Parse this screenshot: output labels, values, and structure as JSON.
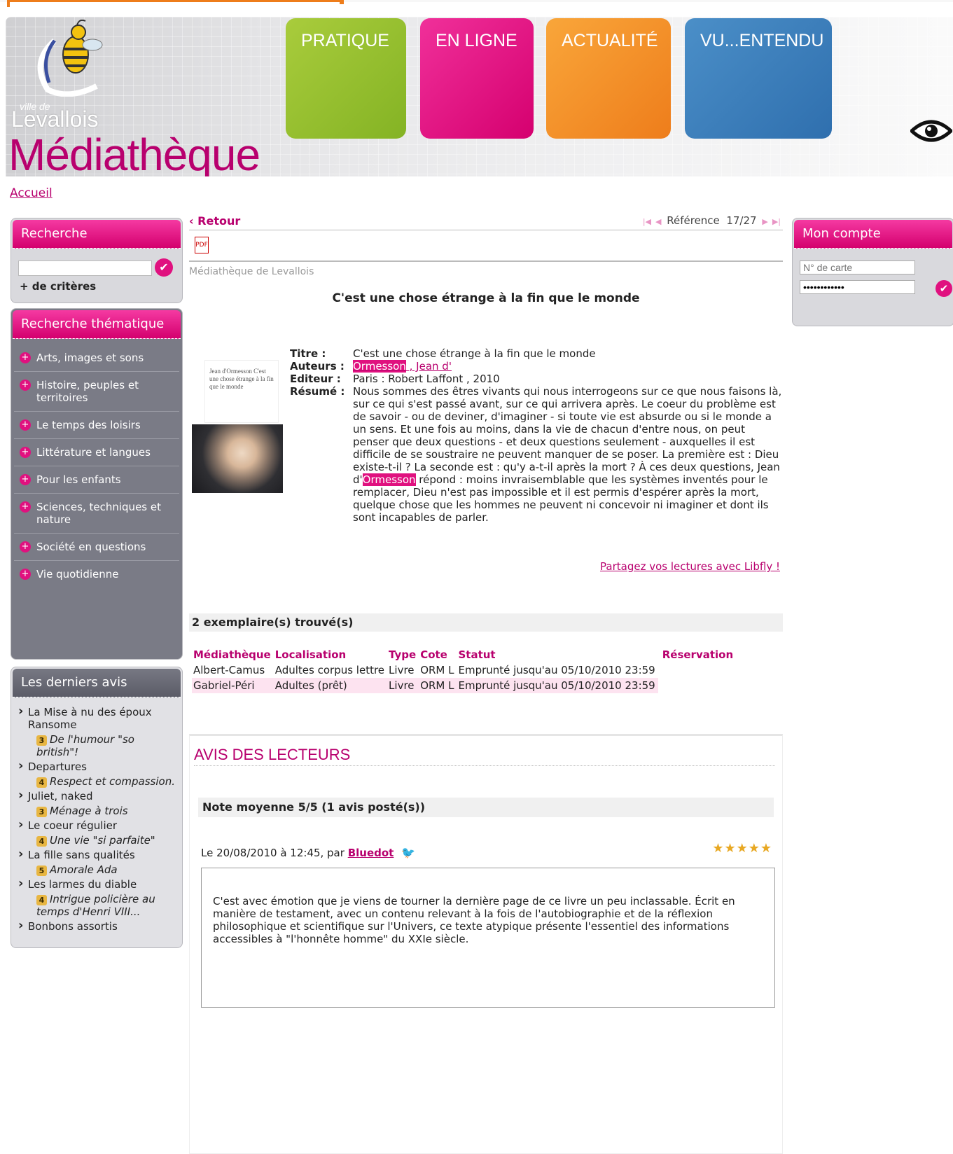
{
  "header": {
    "logo_ville": "ville de",
    "logo_city": "Levallois",
    "logo_title": "Médiathèque",
    "tabs": [
      "PRATIQUE",
      "EN LIGNE",
      "ACTUALITÉ",
      "VU...ENTENDU"
    ]
  },
  "breadcrumb": {
    "home": "Accueil"
  },
  "search": {
    "title": "Recherche",
    "criteria": "+ de critères",
    "value": ""
  },
  "theme": {
    "title": "Recherche thématique",
    "items": [
      "Arts, images et sons",
      "Histoire, peuples et territoires",
      "Le temps des loisirs",
      "Littérature et langues",
      "Pour les enfants",
      "Sciences, techniques et nature",
      "Société en questions",
      "Vie quotidienne"
    ]
  },
  "latest_reviews": {
    "title": "Les derniers avis",
    "items": [
      {
        "book": "La Mise à nu des époux Ransome",
        "rating": "3",
        "comment": "De l'humour \"so british\"!"
      },
      {
        "book": "Departures",
        "rating": "4",
        "comment": "Respect et compassion."
      },
      {
        "book": "Juliet, naked",
        "rating": "3",
        "comment": "Ménage à trois"
      },
      {
        "book": "Le coeur régulier",
        "rating": "4",
        "comment": "Une vie \"si parfaite\""
      },
      {
        "book": "La fille sans qualités",
        "rating": "5",
        "comment": "Amorale Ada"
      },
      {
        "book": "Les larmes du diable",
        "rating": "4",
        "comment": "Intrigue policière au temps d'Henri VIII..."
      },
      {
        "book": "Bonbons assortis",
        "rating": "",
        "comment": ""
      }
    ]
  },
  "account": {
    "title": "Mon compte",
    "card_placeholder": "N° de carte",
    "password_mask": "••••••••••••"
  },
  "record": {
    "back": "Retour",
    "reference_label": "Référence",
    "reference_value": "17/27",
    "library": "Médiathèque de Levallois",
    "heading": "C'est une chose étrange à la fin que le monde",
    "cover_text": "Jean d'Ormesson C'est une chose étrange à la fin que le monde",
    "labels": {
      "title": "Titre :",
      "authors": "Auteurs :",
      "publisher": "Editeur :",
      "summary": "Résumé :"
    },
    "title": "C'est une chose étrange à la fin que le monde",
    "author_hl": "Ormesson",
    "author_rest": " , Jean d'",
    "publisher": "Paris : Robert Laffont , 2010",
    "summary_part1": "Nous sommes des êtres vivants qui nous interrogeons sur ce que nous faisons là, sur ce qui s'est passé avant, sur ce qui arrivera après. Le coeur du problème est de savoir - ou de deviner, d'imaginer - si toute vie est absurde ou si le monde a un sens. Et une fois au moins, dans la vie de chacun d'entre nous, on peut penser que deux questions - et deux questions seulement - auxquelles il est difficile de se soustraire ne peuvent manquer de se poser. La première est : Dieu existe-t-il ? La seconde est : qu'y a-t-il après la mort ? À ces deux questions, Jean d'",
    "summary_hl": "Ormesson",
    "summary_part2": " répond : moins invraisemblable que les systèmes inventés pour le remplacer, Dieu n'est pas impossible et il est permis d'espérer après la mort, quelque chose que les hommes ne peuvent ni concevoir ni imaginer et dont ils sont incapables de parler.",
    "libfly": "Partagez vos lectures avec Libfly !"
  },
  "copies": {
    "heading": "2 exemplaire(s) trouvé(s)",
    "columns": [
      "Médiathèque",
      "Localisation",
      "Type",
      "Cote",
      "Statut",
      "Réservation"
    ],
    "rows": [
      [
        "Albert-Camus",
        "Adultes corpus lettre",
        "Livre",
        "ORM L",
        "Emprunté jusqu'au 05/10/2010 23:59",
        ""
      ],
      [
        "Gabriel-Péri",
        "Adultes (prêt)",
        "Livre",
        "ORM L",
        "Emprunté jusqu'au 05/10/2010 23:59",
        ""
      ]
    ]
  },
  "reader_reviews": {
    "title": "AVIS DES LECTEURS",
    "average": "Note moyenne 5/5 (1 avis posté(s))",
    "meta_prefix": "Le 20/08/2010 à 12:45, par",
    "author": "Bluedot",
    "stars": "★★★★★",
    "text": "C'est avec émotion que je viens de tourner la dernière page de ce livre un peu inclassable. Écrit en manière de testament, avec un contenu relevant à la fois de l'autobiographie et de la réflexion philosophique et scientifique sur l'Univers, ce texte atypique présente l'essentiel des informations accessibles à \"l'honnête homme\" du XXIe siècle."
  },
  "colors": {
    "brand": "#b8006e",
    "accent": "#e0117f",
    "green": "#84b324",
    "orange": "#ee7d1b",
    "blue": "#2f6fae"
  },
  "icons": [
    "bee-logo",
    "eye-icon",
    "pdf-icon",
    "check-icon",
    "plus-icon",
    "bird-icon",
    "star-icon"
  ]
}
